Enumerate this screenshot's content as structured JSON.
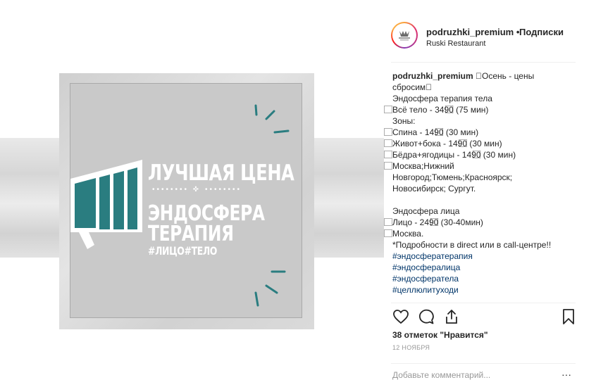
{
  "post": {
    "username": "podruzhki_premium",
    "separator": "•",
    "follow_label": "Подписки",
    "location": "Ruski Restaurant",
    "likes_text": "38 отметок \"Нравится\"",
    "date": "12 НОЯБРЯ",
    "comment_placeholder": "Добавьте комментарий...",
    "more_label": "···"
  },
  "image": {
    "line1": "ЛУЧШАЯ ЦЕНА",
    "line2": "ЭНДОСФЕРА",
    "line3": "ТЕРАПИЯ",
    "line4": "#ЛИЦО#ТЕЛО",
    "dots": "•••••••• ✜ ••••••••",
    "accent_color": "#2a7d80"
  },
  "caption": {
    "username": "podruzhki_premium",
    "lines": [
      " ⃞Осень - цены",
      "сбросим⃞",
      "Эндосфера терапия тела",
      "⃞Всё тело - 3490⃞ (75 мин)",
      "Зоны:",
      "⃞Спина - 1490⃞ (30 мин)",
      "⃞Живот+бока - 1490⃞ (30 мин)",
      "⃞Бёдра+ягодицы - 1490⃞ (30 мин)",
      "⃞Москва;Нижний",
      "Новгород;Тюмень;Красноярск;",
      "Новосибирск; Сургут.",
      "",
      "Эндосфера лица",
      "⃞Лицо - 2490⃞ (30-40мин)",
      "⃞Москва.",
      "*Подробности в direct или в call-центре!!"
    ],
    "hashtags": [
      "#эндосфератерапия",
      "#эндосфералица",
      "#эндосфератела",
      "#целлюлитуходи"
    ]
  },
  "icons": [
    "heart-icon",
    "comment-icon",
    "share-icon",
    "bookmark-icon",
    "megaphone-icon",
    "avatar-logo"
  ]
}
